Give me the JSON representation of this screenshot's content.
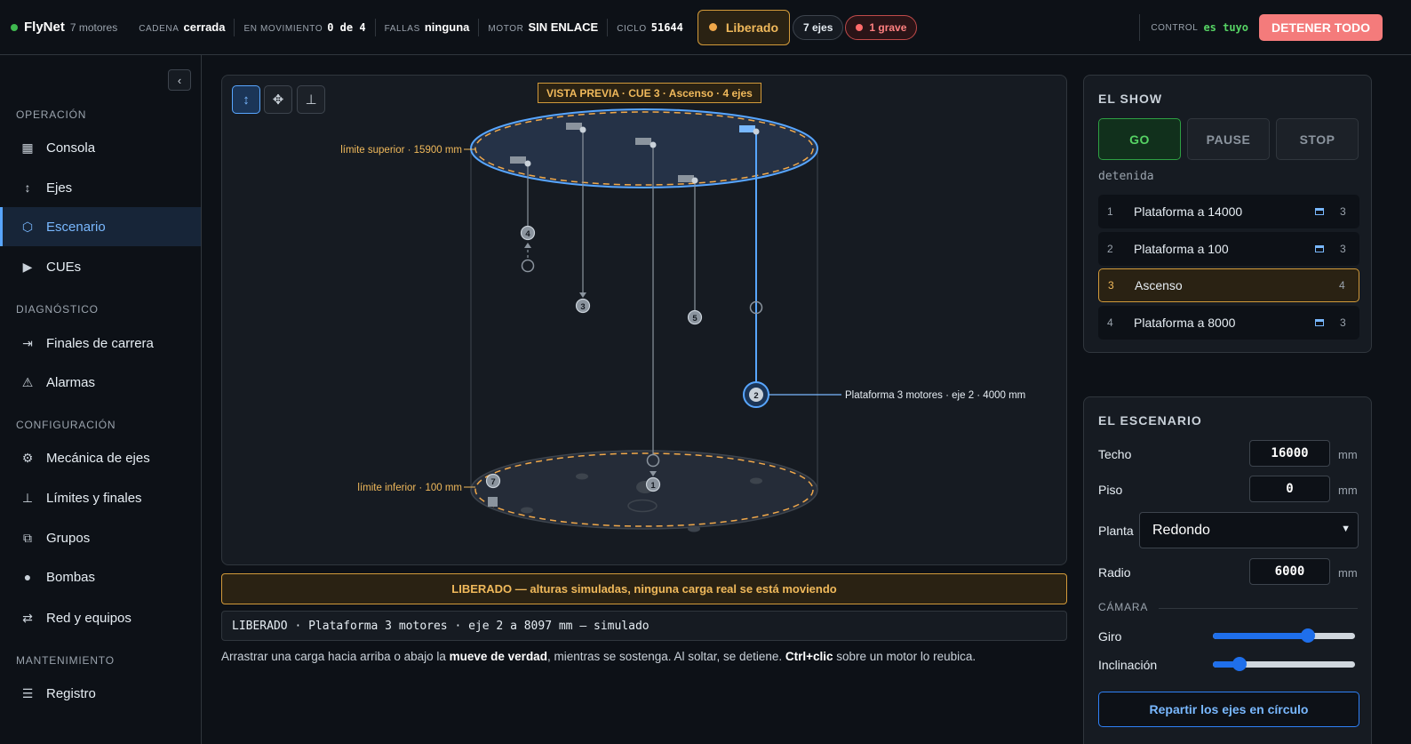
{
  "topbar": {
    "brand": "FlyNet",
    "motors": "7 motores",
    "stats": [
      {
        "key": "Cadena",
        "value": "cerrada"
      },
      {
        "key": "En movimiento",
        "value": "0 de 4"
      },
      {
        "key": "Fallas",
        "value": "ninguna"
      },
      {
        "key": "Motor",
        "value": "SIN ENLACE"
      },
      {
        "key": "Ciclo",
        "value": "51644"
      }
    ],
    "released_label": "Liberado",
    "axes_label": "7 ejes",
    "fault_label": "1 grave",
    "control_key": "CONTROL",
    "control_value": "es tuyo",
    "stop_all_label": "DETENER TODO",
    "colors": {
      "ok": "#3fb950",
      "warn": "#f0b95b",
      "danger": "#f47b7b",
      "accent": "#58a6ff"
    }
  },
  "sidebar": {
    "collapse_icon": "chevron-left-icon",
    "sections": [
      {
        "title": "Operación",
        "items": [
          {
            "label": "Consola",
            "icon": "grid-icon",
            "active": false
          },
          {
            "label": "Ejes",
            "icon": "vertical-arrows-icon",
            "active": false
          },
          {
            "label": "Escenario",
            "icon": "hexagon-icon",
            "active": true
          },
          {
            "label": "CUEs",
            "icon": "play-icon",
            "active": false
          }
        ]
      },
      {
        "title": "Diagnóstico",
        "items": [
          {
            "label": "Finales de carrera",
            "icon": "arrow-to-line-icon",
            "active": false
          },
          {
            "label": "Alarmas",
            "icon": "warning-icon",
            "active": false
          }
        ]
      },
      {
        "title": "Configuración",
        "items": [
          {
            "label": "Mecánica de ejes",
            "icon": "gear-icon",
            "active": false
          },
          {
            "label": "Límites y finales",
            "icon": "limit-icon",
            "active": false
          },
          {
            "label": "Grupos",
            "icon": "group-icon",
            "active": false
          },
          {
            "label": "Bombas",
            "icon": "ball-icon",
            "active": false
          },
          {
            "label": "Red y equipos",
            "icon": "swap-arrows-icon",
            "active": false
          }
        ]
      },
      {
        "title": "Mantenimiento",
        "items": [
          {
            "label": "Registro",
            "icon": "list-icon",
            "active": false
          }
        ]
      }
    ]
  },
  "viewport": {
    "tools": [
      "vertical-move-icon",
      "move-all-icon",
      "limit-tool-icon"
    ],
    "preview_tag": "VISTA PREVIA · CUE 3 · Ascenso · 4 ejes",
    "upper_limit_label": "límite superior · 15900 mm",
    "lower_limit_label": "límite inferior · 100 mm",
    "selected_label": "Plataforma 3 motores · eje 2 · 4000 mm",
    "axis_numbers": [
      "1",
      "2",
      "3",
      "4",
      "5",
      "7"
    ]
  },
  "banner": "LIBERADO — alturas simuladas, ninguna carga real se está moviendo",
  "console_line": "LIBERADO · Plataforma 3 motores · eje 2 a 8097 mm — simulado",
  "hint": {
    "part1": "Arrastrar una carga hacia arriba o abajo la ",
    "bold1": "mueve de verdad",
    "part2": ", mientras se sostenga. Al soltar, se detiene. ",
    "bold2": "Ctrl+clic",
    "part3": " sobre un motor lo reubica."
  },
  "show": {
    "title": "EL SHOW",
    "go": "GO",
    "pause": "PAUSE",
    "stop": "STOP",
    "state": "detenida",
    "cues": [
      {
        "num": "1",
        "name": "Plataforma a 14000",
        "count": "3",
        "icon": true,
        "active": false
      },
      {
        "num": "2",
        "name": "Plataforma a 100",
        "count": "3",
        "icon": true,
        "active": false
      },
      {
        "num": "3",
        "name": "Ascenso",
        "count": "4",
        "icon": false,
        "active": true
      },
      {
        "num": "4",
        "name": "Plataforma a 8000",
        "count": "3",
        "icon": true,
        "active": false
      }
    ]
  },
  "stage": {
    "title": "EL ESCENARIO",
    "techo_label": "Techo",
    "techo_value": "16000",
    "piso_label": "Piso",
    "piso_value": "0",
    "planta_label": "Planta",
    "planta_value": "Redondo",
    "radio_label": "Radio",
    "radio_value": "6000",
    "unit": "mm",
    "camera_title": "Cámara",
    "giro_label": "Giro",
    "giro_level": 0.67,
    "incl_label": "Inclinación",
    "incl_level": 0.19,
    "spread_label": "Repartir los ejes en círculo"
  }
}
